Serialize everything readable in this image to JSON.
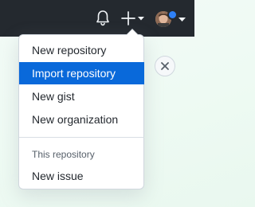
{
  "header": {
    "icons": [
      "bell-icon",
      "plus-icon",
      "chevron-down-icon",
      "avatar"
    ],
    "notification_dot_color": "#2f81f7"
  },
  "create_menu": {
    "items": [
      {
        "label": "New repository"
      },
      {
        "label": "Import repository",
        "active": true
      },
      {
        "label": "New gist"
      },
      {
        "label": "New organization"
      }
    ],
    "section_label": "This repository",
    "section_items": [
      {
        "label": "New issue"
      }
    ],
    "highlight_color": "#0969da"
  },
  "banner": {
    "close_icon": "close-icon"
  }
}
